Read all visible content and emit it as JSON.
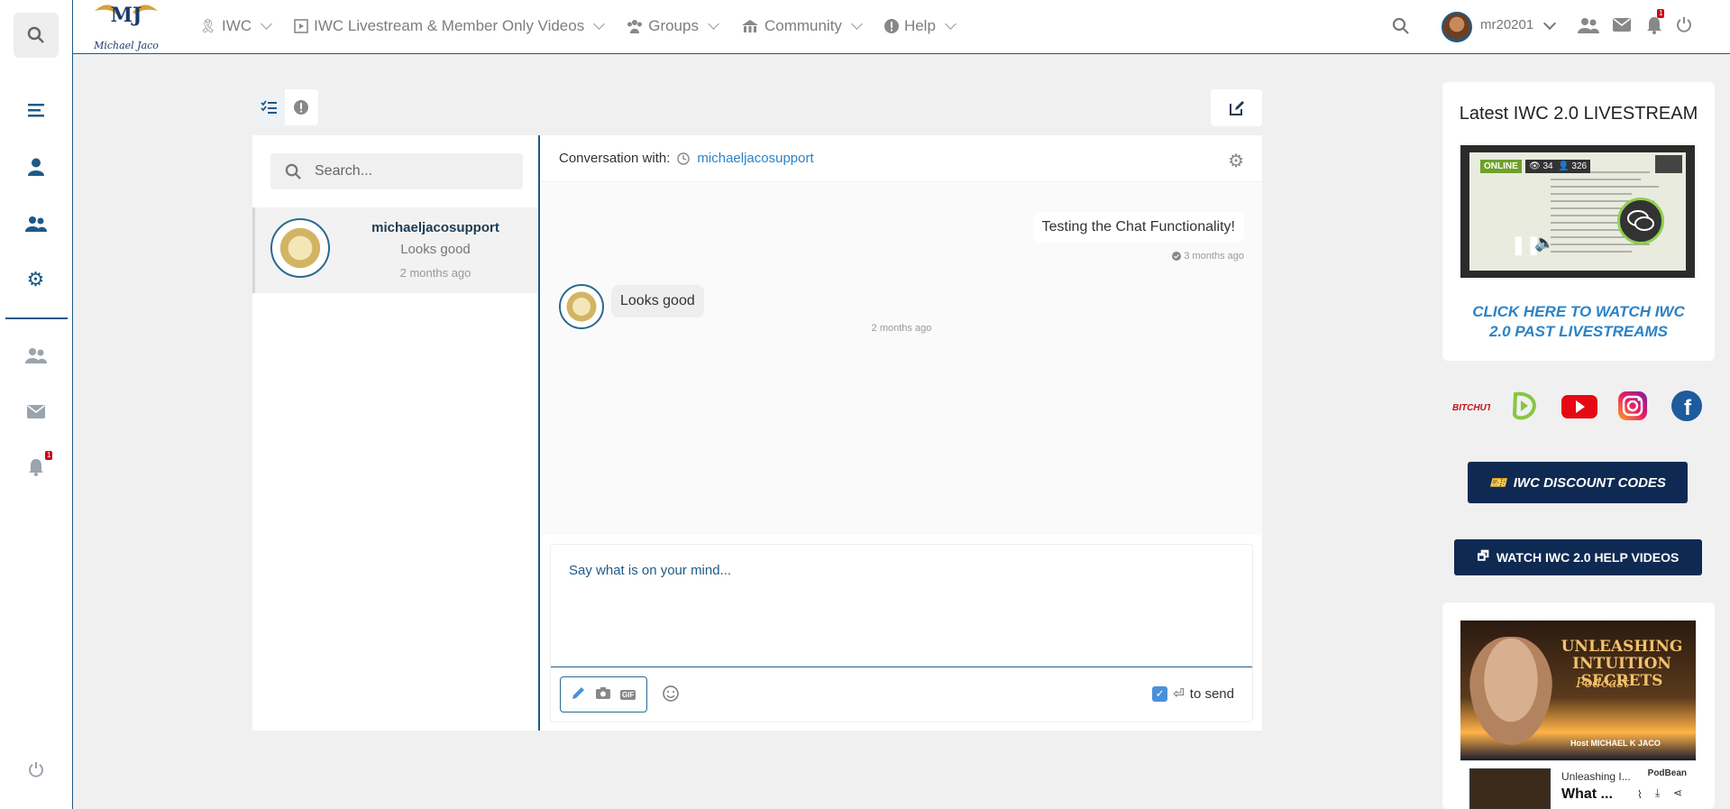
{
  "topbar": {
    "nav": [
      {
        "label": "IWC",
        "icon": "ribbon-icon"
      },
      {
        "label": "IWC Livestream & Member Only Videos",
        "icon": "video-icon"
      },
      {
        "label": "Groups",
        "icon": "groups-icon"
      },
      {
        "label": "Community",
        "icon": "community-icon"
      },
      {
        "label": "Help",
        "icon": "help-icon"
      }
    ],
    "username": "mr20201",
    "notification_count": "1"
  },
  "logo": {
    "initials": "MJ",
    "name": "Michael Jaco"
  },
  "rail": {
    "notification_count": "1"
  },
  "search": {
    "placeholder": "Search..."
  },
  "conversations": [
    {
      "name": "michaeljacosupport",
      "preview": "Looks good",
      "time": "2 months ago"
    }
  ],
  "conversation": {
    "label": "Conversation with:",
    "with": "michaeljacosupport",
    "messages": [
      {
        "direction": "out",
        "text": "Testing the Chat Functionality!",
        "time": "3 months ago"
      },
      {
        "direction": "in",
        "text": "Looks good",
        "time": "2 months ago"
      }
    ]
  },
  "composer": {
    "placeholder": "Say what is on your mind...",
    "enter_to_send": true,
    "send_label": "to send",
    "gif_label": "GIF"
  },
  "sidebar": {
    "live_title": "Latest IWC 2.0 LIVESTREAM",
    "live_online": "ONLINE",
    "live_views": "34",
    "live_viewers": "326",
    "past_link": "CLICK HERE TO WATCH IWC 2.0 PAST LIVESTREAMS",
    "social": [
      "bitchute-icon",
      "rumble-icon",
      "youtube-icon",
      "instagram-icon",
      "facebook-icon"
    ],
    "social_bitchute_text": "BITCHUTE",
    "discount_button": "IWC DISCOUNT CODES",
    "help_button": "WATCH IWC 2.0 HELP VIDEOS",
    "podcast": {
      "title_line1": "UNLEASHING",
      "title_line2": "INTUITION SECRETS",
      "subtitle": "Podcast",
      "host": "Host MICHAEL K JACO",
      "player_line1": "Unleashing I...",
      "player_line2": "What ...",
      "brand": "PodBean"
    }
  },
  "colors": {
    "brand": "#1e5a87",
    "link": "#2b83c7",
    "button": "#0f2a52",
    "badge": "#d0021b"
  }
}
